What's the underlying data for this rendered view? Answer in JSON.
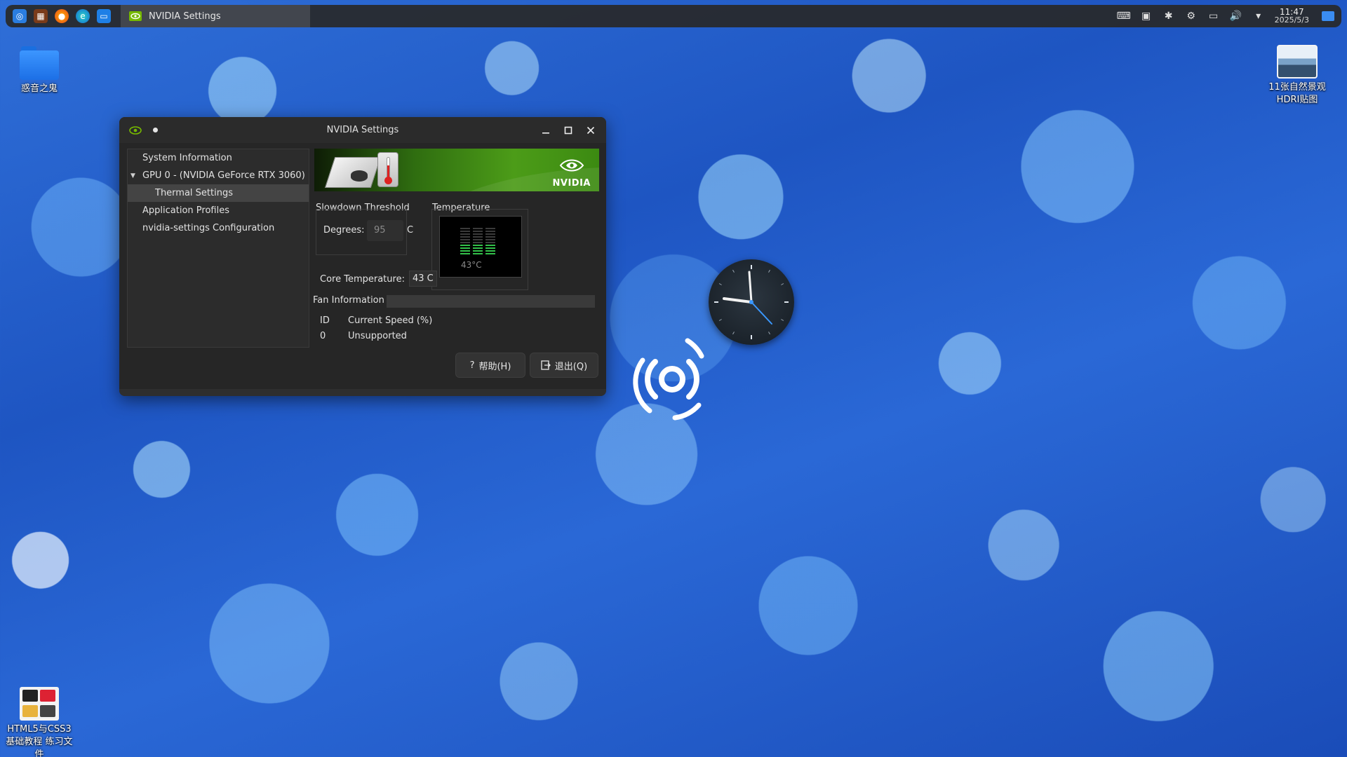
{
  "taskbar": {
    "task_title": "NVIDIA Settings",
    "time": "11:47",
    "date": "2025/5/3"
  },
  "desktop": {
    "icons": [
      {
        "label": "惑音之鬼"
      },
      {
        "label": "11张自然景观HDRI贴图"
      },
      {
        "label": "HTML5与CSS3基础教程 练习文件"
      }
    ]
  },
  "window": {
    "title": "NVIDIA Settings",
    "tree": {
      "system_information": "System Information",
      "gpu": "GPU 0 - (NVIDIA GeForce RTX 3060)",
      "thermal_settings": "Thermal Settings",
      "application_profiles": "Application Profiles",
      "configuration": "nvidia-settings Configuration"
    },
    "banner_logo_text": "NVIDIA",
    "slowdown": {
      "title": "Slowdown Threshold",
      "degrees_label": "Degrees:",
      "degrees_value": "95",
      "unit": "C"
    },
    "temperature": {
      "title": "Temperature",
      "readout": "43°C",
      "level": 0.43
    },
    "core": {
      "label": "Core Temperature:",
      "value": "43 C"
    },
    "fan": {
      "title": "Fan Information",
      "columns": [
        "ID",
        "Current Speed (%)"
      ],
      "rows": [
        [
          "0",
          "Unsupported"
        ]
      ]
    },
    "buttons": {
      "help": "帮助(H)",
      "quit": "退出(Q)"
    }
  },
  "colors": {
    "nvidia_green": "#76b900",
    "accent_blue": "#3a8cf0"
  }
}
